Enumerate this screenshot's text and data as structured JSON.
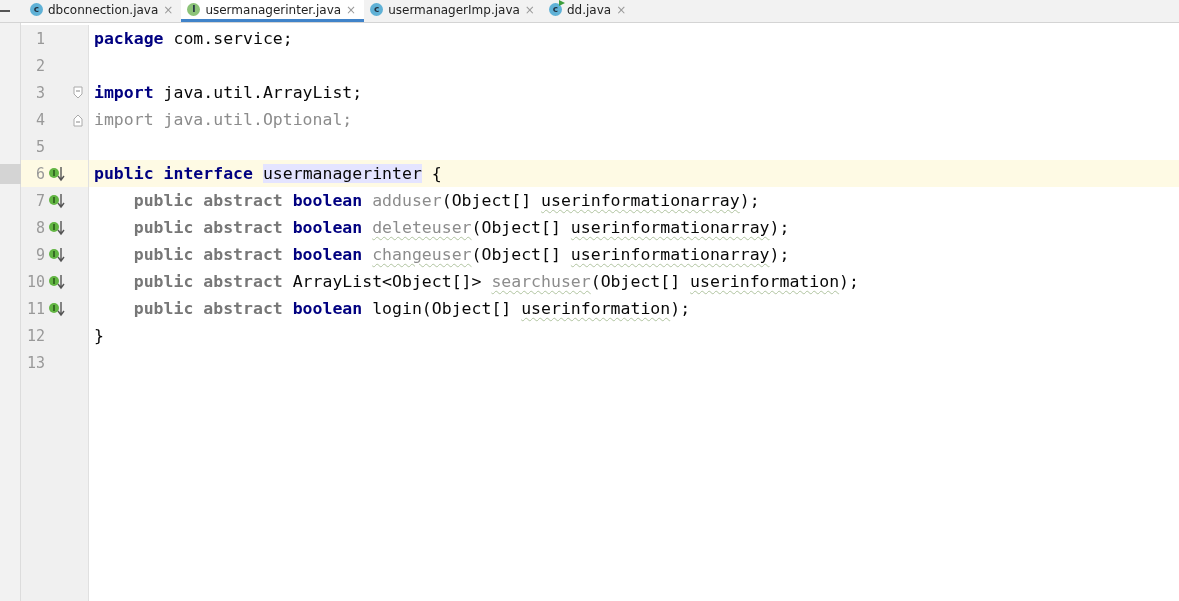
{
  "tabs": [
    {
      "label": "dbconnection.java",
      "kind": "class",
      "icon_letter": "c",
      "close": "×",
      "selected": false
    },
    {
      "label": "usermanagerinter.java",
      "kind": "interface",
      "icon_letter": "I",
      "close": "×",
      "selected": true
    },
    {
      "label": "usermanagerImp.java",
      "kind": "class",
      "icon_letter": "c",
      "close": "×",
      "selected": false
    },
    {
      "label": "dd.java",
      "kind": "runnable-class",
      "icon_letter": "c",
      "close": "×",
      "selected": false
    }
  ],
  "lines": [
    {
      "number": "1",
      "implemented": false,
      "current": false,
      "fold_start": false,
      "fold_end": false,
      "tokens": [
        {
          "text": "package",
          "kind": "keyword"
        },
        {
          "text": " com.service;",
          "kind": "plain"
        }
      ]
    },
    {
      "number": "2",
      "implemented": false,
      "current": false,
      "fold_start": false,
      "fold_end": false
    },
    {
      "number": "3",
      "implemented": false,
      "current": false,
      "fold_start": true,
      "fold_end": false,
      "tokens": [
        {
          "text": "import",
          "kind": "keyword"
        },
        {
          "text": " java.util.ArrayList;",
          "kind": "plain"
        }
      ]
    },
    {
      "number": "4",
      "implemented": false,
      "current": false,
      "fold_start": false,
      "fold_end": true,
      "tokens": [
        {
          "text": "import java.util.Optional;",
          "kind": "unused"
        }
      ]
    },
    {
      "number": "5",
      "implemented": false,
      "current": false,
      "fold_start": false,
      "fold_end": false
    },
    {
      "number": "6",
      "implemented": true,
      "current": true,
      "fold_start": false,
      "fold_end": false,
      "tokens": [
        {
          "text": "public interface ",
          "kind": "keyword"
        },
        {
          "text": "usermanagerinter",
          "kind": "highlight"
        },
        {
          "text": " {",
          "kind": "plain"
        }
      ]
    },
    {
      "number": "7",
      "implemented": true,
      "current": false,
      "fold_start": false,
      "fold_end": false,
      "tokens": [
        {
          "text": "    public abstract ",
          "kind": "modifier"
        },
        {
          "text": "boolean ",
          "kind": "keyword"
        },
        {
          "text": "adduser",
          "kind": "unused"
        },
        {
          "text": "(Object[] ",
          "kind": "plain"
        },
        {
          "text": "userinformationarray",
          "kind": "typo"
        },
        {
          "text": ");",
          "kind": "plain"
        }
      ]
    },
    {
      "number": "8",
      "implemented": true,
      "current": false,
      "fold_start": false,
      "fold_end": false,
      "tokens": [
        {
          "text": "    public abstract ",
          "kind": "modifier"
        },
        {
          "text": "boolean ",
          "kind": "keyword"
        },
        {
          "text": "deleteuser",
          "kind": "unused-typo"
        },
        {
          "text": "(Object[] ",
          "kind": "plain"
        },
        {
          "text": "userinformationarray",
          "kind": "typo"
        },
        {
          "text": ");",
          "kind": "plain"
        }
      ]
    },
    {
      "number": "9",
      "implemented": true,
      "current": false,
      "fold_start": false,
      "fold_end": false,
      "tokens": [
        {
          "text": "    public abstract ",
          "kind": "modifier"
        },
        {
          "text": "boolean ",
          "kind": "keyword"
        },
        {
          "text": "changeuser",
          "kind": "unused-typo"
        },
        {
          "text": "(Object[] ",
          "kind": "plain"
        },
        {
          "text": "userinformationarray",
          "kind": "typo"
        },
        {
          "text": ");",
          "kind": "plain"
        }
      ]
    },
    {
      "number": "10",
      "implemented": true,
      "current": false,
      "fold_start": false,
      "fold_end": false,
      "tokens": [
        {
          "text": "    public abstract ",
          "kind": "modifier"
        },
        {
          "text": "ArrayList<Object[]> ",
          "kind": "plain"
        },
        {
          "text": "searchuser",
          "kind": "unused-typo"
        },
        {
          "text": "(Object[] ",
          "kind": "plain"
        },
        {
          "text": "userinformation",
          "kind": "typo"
        },
        {
          "text": ");",
          "kind": "plain"
        }
      ]
    },
    {
      "number": "11",
      "implemented": true,
      "current": false,
      "fold_start": false,
      "fold_end": false,
      "tokens": [
        {
          "text": "    public abstract ",
          "kind": "modifier"
        },
        {
          "text": "boolean ",
          "kind": "keyword"
        },
        {
          "text": "login(Object[] ",
          "kind": "plain"
        },
        {
          "text": "userinformation",
          "kind": "typo"
        },
        {
          "text": ");",
          "kind": "plain"
        }
      ]
    },
    {
      "number": "12",
      "implemented": false,
      "current": false,
      "fold_start": false,
      "fold_end": false,
      "tokens": [
        {
          "text": "}",
          "kind": "plain"
        }
      ]
    },
    {
      "number": "13",
      "implemented": false,
      "current": false,
      "fold_start": false,
      "fold_end": false
    }
  ]
}
